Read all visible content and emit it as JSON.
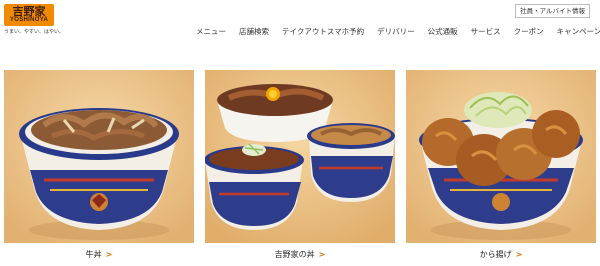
{
  "brand": {
    "kanji": "吉野家",
    "roman": "YOSHINOYA",
    "tagline": "うまい、やすい、はやい。",
    "color": "#f08a00"
  },
  "header": {
    "recruit_link": "社員・アルバイト情報"
  },
  "nav": {
    "items": [
      {
        "label": "メニュー"
      },
      {
        "label": "店舗検索"
      },
      {
        "label": "テイクアウトスマホ予約"
      },
      {
        "label": "デリバリー"
      },
      {
        "label": "公式通販"
      },
      {
        "label": "サービス"
      },
      {
        "label": "クーポン"
      },
      {
        "label": "キャンペーン"
      }
    ]
  },
  "cards": [
    {
      "label": "牛丼",
      "arrow": ">",
      "icon": "gyudon-bowl-photo"
    },
    {
      "label": "吉野家の丼",
      "arrow": ">",
      "icon": "yoshinoya-bowls-photo"
    },
    {
      "label": "から揚げ",
      "arrow": ">",
      "icon": "karaage-bowl-photo"
    }
  ],
  "colors": {
    "accent": "#e07000",
    "photo_background": "#efc991"
  }
}
